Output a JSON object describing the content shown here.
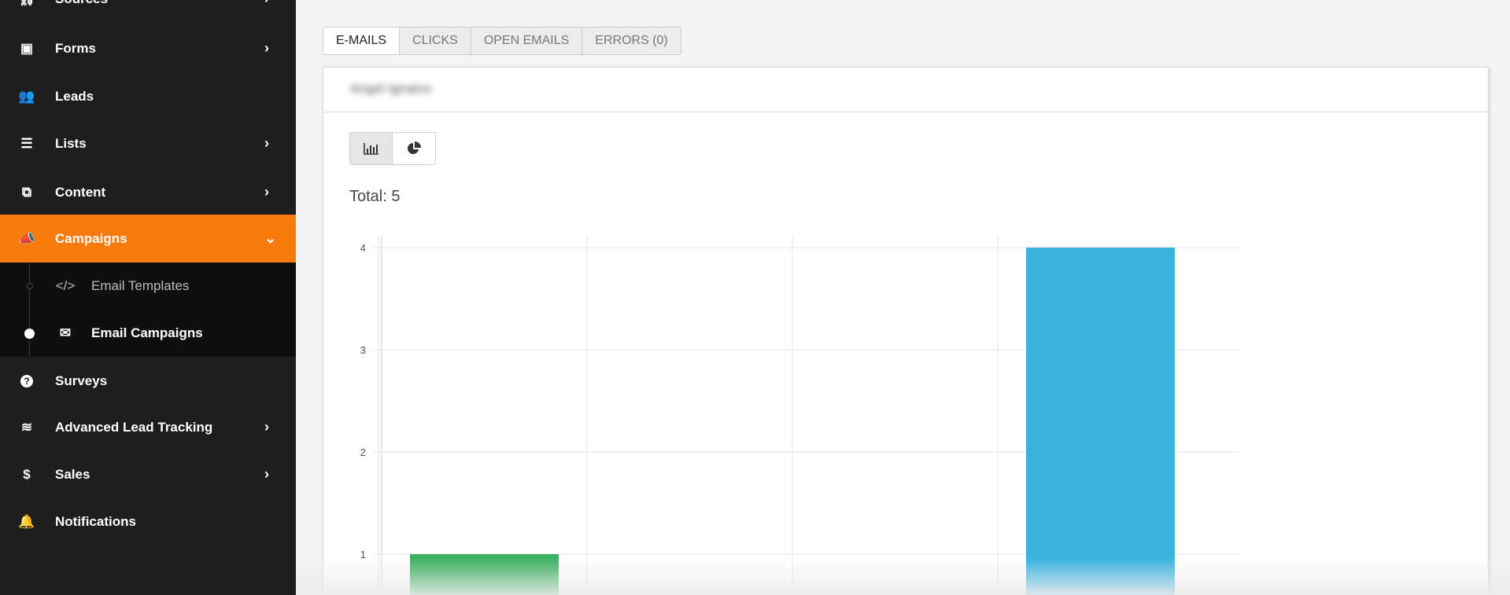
{
  "sidebar": {
    "items": [
      {
        "label": "Sources",
        "icon": "sitemap-icon",
        "chevron": true
      },
      {
        "label": "Forms",
        "icon": "form-icon",
        "chevron": true
      },
      {
        "label": "Leads",
        "icon": "users-icon",
        "chevron": false
      },
      {
        "label": "Lists",
        "icon": "list-icon",
        "chevron": true
      },
      {
        "label": "Content",
        "icon": "content-icon",
        "chevron": true
      },
      {
        "label": "Campaigns",
        "icon": "bullhorn-icon",
        "chevron": true,
        "active": true
      },
      {
        "label": "Surveys",
        "icon": "question-circle-icon",
        "chevron": false
      },
      {
        "label": "Advanced Lead Tracking",
        "icon": "database-icon",
        "chevron": true
      },
      {
        "label": "Sales",
        "icon": "dollar-icon",
        "chevron": true
      },
      {
        "label": "Notifications",
        "icon": "bell-icon",
        "chevron": false
      }
    ],
    "submenu": [
      {
        "label": "Email Templates",
        "icon": "code-icon",
        "active": false
      },
      {
        "label": "Email Campaigns",
        "icon": "envelope-icon",
        "active": true
      }
    ],
    "active_color": "#f97a0d"
  },
  "tabs": [
    "E-MAILS",
    "CLICKS",
    "OPEN EMAILS",
    "ERRORS (0)"
  ],
  "card": {
    "title": "Angel Ignatov",
    "view_toggle": [
      "bar-chart-icon",
      "pie-chart-icon"
    ],
    "total": "Total: 5"
  },
  "chart_data": {
    "type": "bar",
    "categories": [
      "",
      "",
      "",
      ""
    ],
    "values": [
      1,
      0,
      0,
      4
    ],
    "colors": [
      "#3cb160",
      "#999999",
      "#999999",
      "#3ab4df"
    ],
    "yticks": [
      "1",
      "2",
      "3",
      "4"
    ],
    "ylim": [
      0,
      4
    ],
    "grid": true
  }
}
